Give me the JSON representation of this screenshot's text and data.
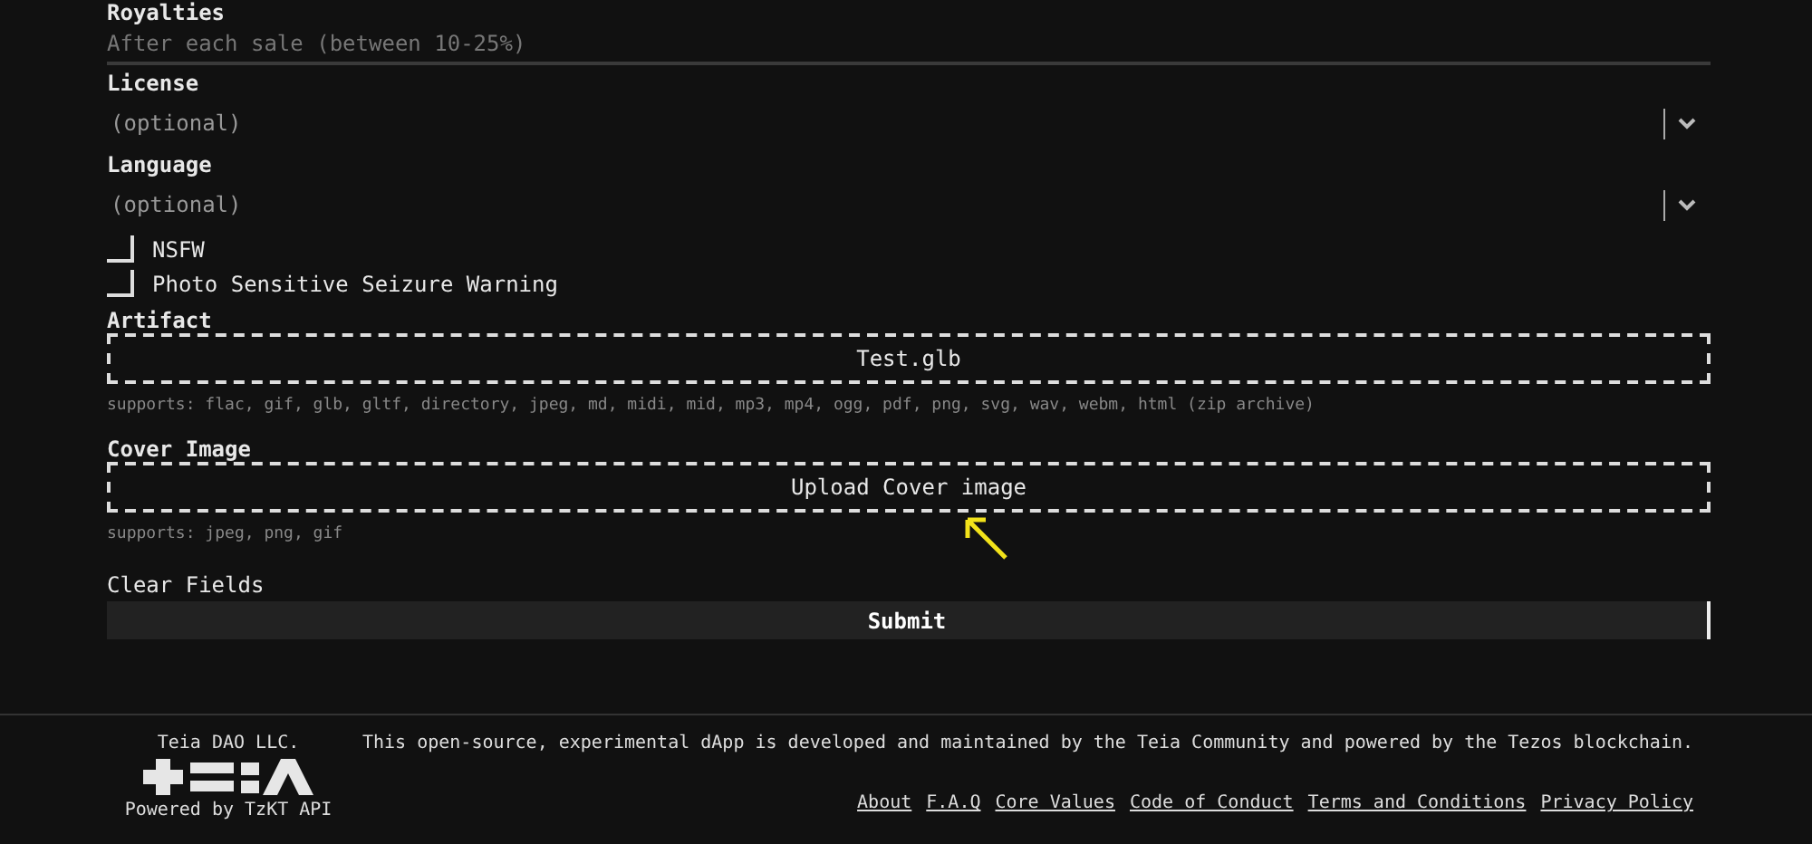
{
  "royalties": {
    "label": "Royalties",
    "placeholder": "After each sale (between 10-25%)"
  },
  "selects": [
    {
      "label": "License",
      "placeholder": "(optional)"
    },
    {
      "label": "Language",
      "placeholder": "(optional)"
    }
  ],
  "checkboxes": [
    {
      "label": "NSFW",
      "checked": false
    },
    {
      "label": "Photo Sensitive Seizure Warning",
      "checked": false
    }
  ],
  "uploads": [
    {
      "label": "Artifact",
      "value": "Test.glb",
      "supports": "supports: flac, gif, glb, gltf, directory, jpeg, md, midi, mid, mp3, mp4, ogg, pdf, png, svg, wav, webm, html (zip archive)"
    },
    {
      "label": "Cover Image",
      "value": "Upload Cover image",
      "supports": "supports: jpeg, png, gif"
    }
  ],
  "clear_fields": "Clear Fields",
  "submit": "Submit",
  "footer": {
    "company": "Teia DAO LLC.",
    "powered_by": "Powered by TzKT API",
    "description": "This open-source, experimental dApp is developed and maintained by the Teia Community and powered by the Tezos blockchain.",
    "links": [
      "About",
      "F.A.Q",
      "Core Values",
      "Code of Conduct",
      "Terms and Conditions",
      "Privacy Policy"
    ]
  }
}
